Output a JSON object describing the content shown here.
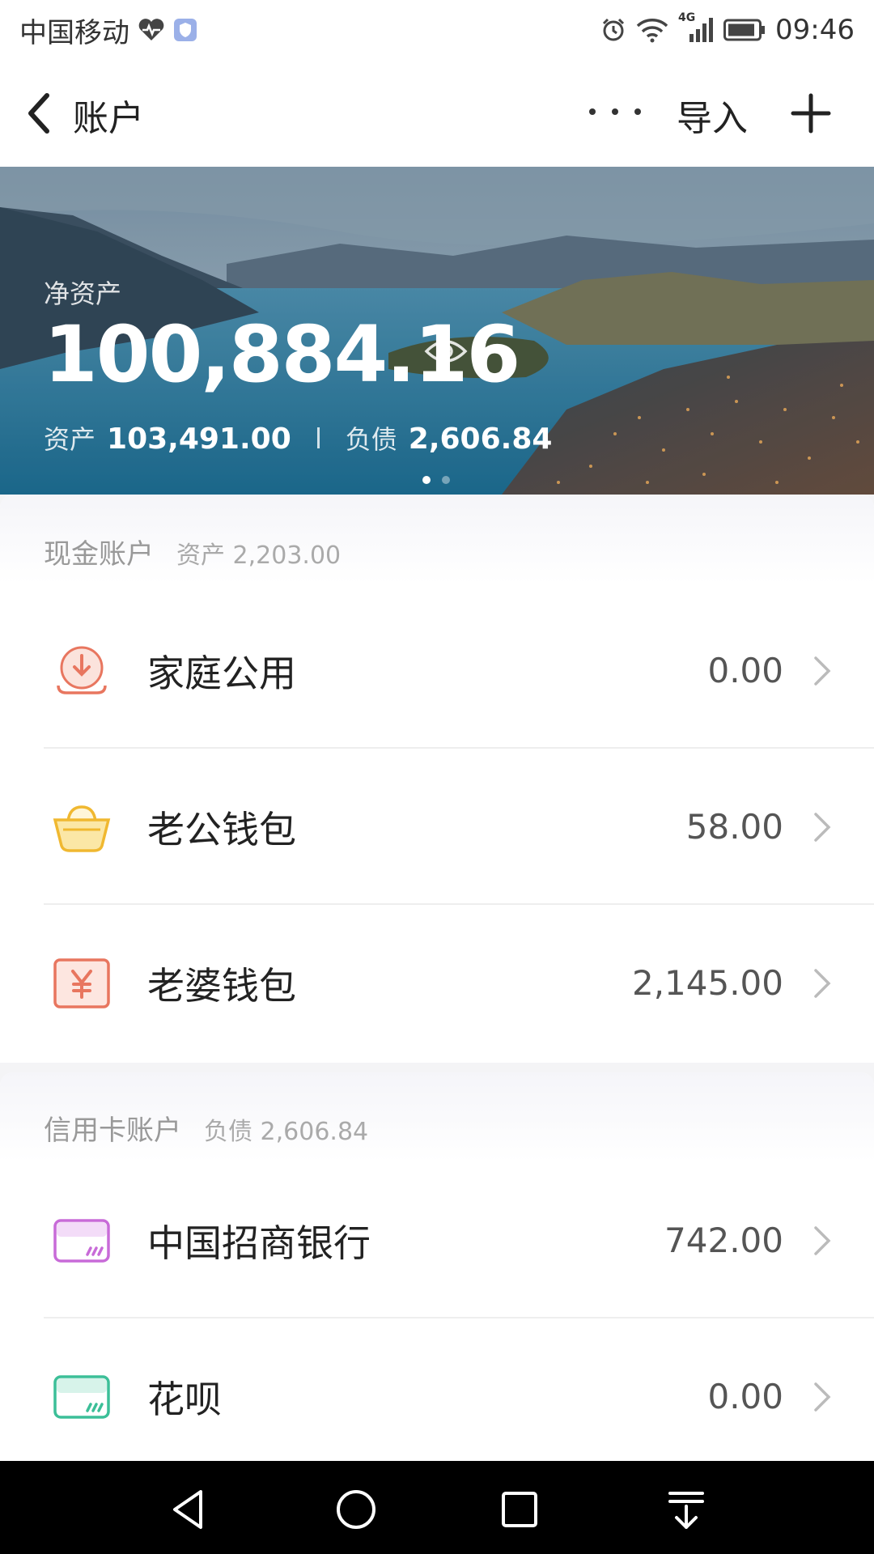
{
  "status_bar": {
    "carrier": "中国移动",
    "network": "4G",
    "time": "09:46"
  },
  "header": {
    "title": "账户",
    "import_label": "导入"
  },
  "hero": {
    "net_assets_label": "净资产",
    "net_assets_value": "100,884.16",
    "assets_label": "资产",
    "assets_value": "103,491.00",
    "liabilities_label": "负债",
    "liabilities_value": "2,606.84",
    "carousel_pages": 2,
    "carousel_active": 1
  },
  "cash_section": {
    "title": "现金账户",
    "summary_label": "资产",
    "summary_value": "2,203.00",
    "accounts": [
      {
        "name": "家庭公用",
        "amount": "0.00",
        "icon": "download-circle-icon",
        "color": "#e8765f"
      },
      {
        "name": "老公钱包",
        "amount": "58.00",
        "icon": "gold-ingot-icon",
        "color": "#f0b830"
      },
      {
        "name": "老婆钱包",
        "amount": "2,145.00",
        "icon": "yuan-icon",
        "color": "#e8765f"
      }
    ]
  },
  "credit_section": {
    "title": "信用卡账户",
    "summary_label": "负债",
    "summary_value": "2,606.84",
    "accounts": [
      {
        "name": "中国招商银行",
        "amount": "742.00",
        "icon": "credit-card-icon",
        "color": "#c86bd8"
      },
      {
        "name": "花呗",
        "amount": "0.00",
        "icon": "credit-card-icon",
        "color": "#3cbf98"
      }
    ]
  },
  "colors": {
    "accent_orange": "#e8765f",
    "accent_gold": "#f0b830",
    "accent_purple": "#c86bd8",
    "accent_green": "#3cbf98"
  }
}
